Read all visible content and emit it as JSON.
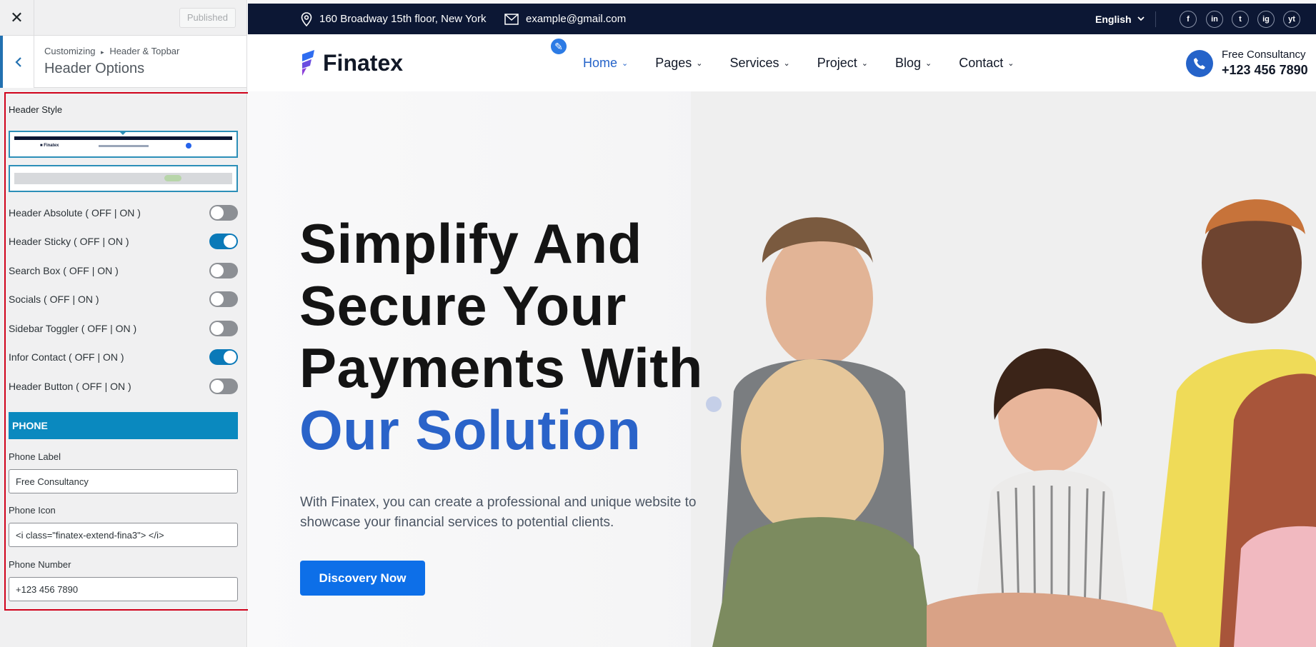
{
  "customizer": {
    "close_glyph": "✕",
    "publish_label": "Published",
    "breadcrumb_root": "Customizing",
    "breadcrumb_sep": "▸",
    "breadcrumb_parent": "Header & Topbar",
    "section_title": "Header Options",
    "header_style_label": "Header Style",
    "toggles": [
      {
        "label": "Header Absolute ( OFF | ON )",
        "on": false
      },
      {
        "label": "Header Sticky ( OFF | ON )",
        "on": true
      },
      {
        "label": "Search Box ( OFF | ON )",
        "on": false
      },
      {
        "label": "Socials ( OFF | ON )",
        "on": false
      },
      {
        "label": "Sidebar Toggler ( OFF | ON )",
        "on": false
      },
      {
        "label": "Infor Contact ( OFF | ON )",
        "on": true
      },
      {
        "label": "Header Button ( OFF | ON )",
        "on": false
      }
    ],
    "phone_section": "PHONE",
    "phone_label_label": "Phone Label",
    "phone_label_value": "Free Consultancy",
    "phone_icon_label": "Phone Icon",
    "phone_icon_value": "<i class=\"finatex-extend-fina3\"> </i>",
    "phone_number_label": "Phone Number",
    "phone_number_value": "+123 456 7890",
    "accent_color": "#0a89bf"
  },
  "site": {
    "topbar": {
      "address": "160 Broadway 15th floor, New York",
      "email": "example@gmail.com",
      "language": "English",
      "socials": [
        "f",
        "in",
        "t",
        "ig",
        "yt"
      ]
    },
    "logo_text": "Finatex",
    "nav": [
      {
        "label": "Home",
        "active": true
      },
      {
        "label": "Pages",
        "active": false
      },
      {
        "label": "Services",
        "active": false
      },
      {
        "label": "Project",
        "active": false
      },
      {
        "label": "Blog",
        "active": false
      },
      {
        "label": "Contact",
        "active": false
      }
    ],
    "contact_label": "Free Consultancy",
    "contact_number": "+123 456 7890",
    "hero": {
      "line1": "Simplify And",
      "line2": "Secure Your",
      "line3": "Payments With",
      "line4": "Our Solution",
      "description": "With Finatex, you can create a professional and unique website to showcase your financial services to potential clients.",
      "cta": "Discovery Now"
    },
    "colors": {
      "dark": "#0c1734",
      "brand_blue": "#2563c9",
      "cta_blue": "#0d6fe8"
    }
  }
}
